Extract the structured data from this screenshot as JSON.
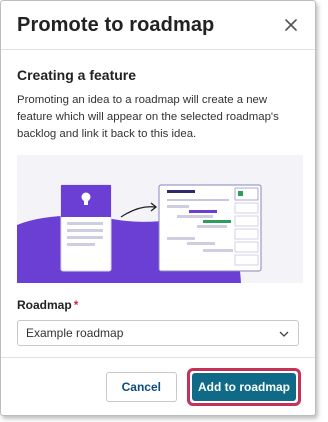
{
  "dialog": {
    "title": "Promote to roadmap",
    "close_icon": "close-icon"
  },
  "section": {
    "title": "Creating a feature",
    "description": "Promoting an idea to a roadmap will create a new feature which will appear on the selected roadmap's backlog and link it back to this idea."
  },
  "roadmap_field": {
    "label": "Roadmap",
    "required_mark": "*",
    "selected_value": "Example roadmap",
    "icon": "chevron-down-icon"
  },
  "footer": {
    "cancel_label": "Cancel",
    "submit_label": "Add to roadmap"
  },
  "colors": {
    "accent": "#0e6a86",
    "highlight": "#c4325a",
    "illustration_purple": "#6b3fd3",
    "required": "#d32a4a"
  }
}
